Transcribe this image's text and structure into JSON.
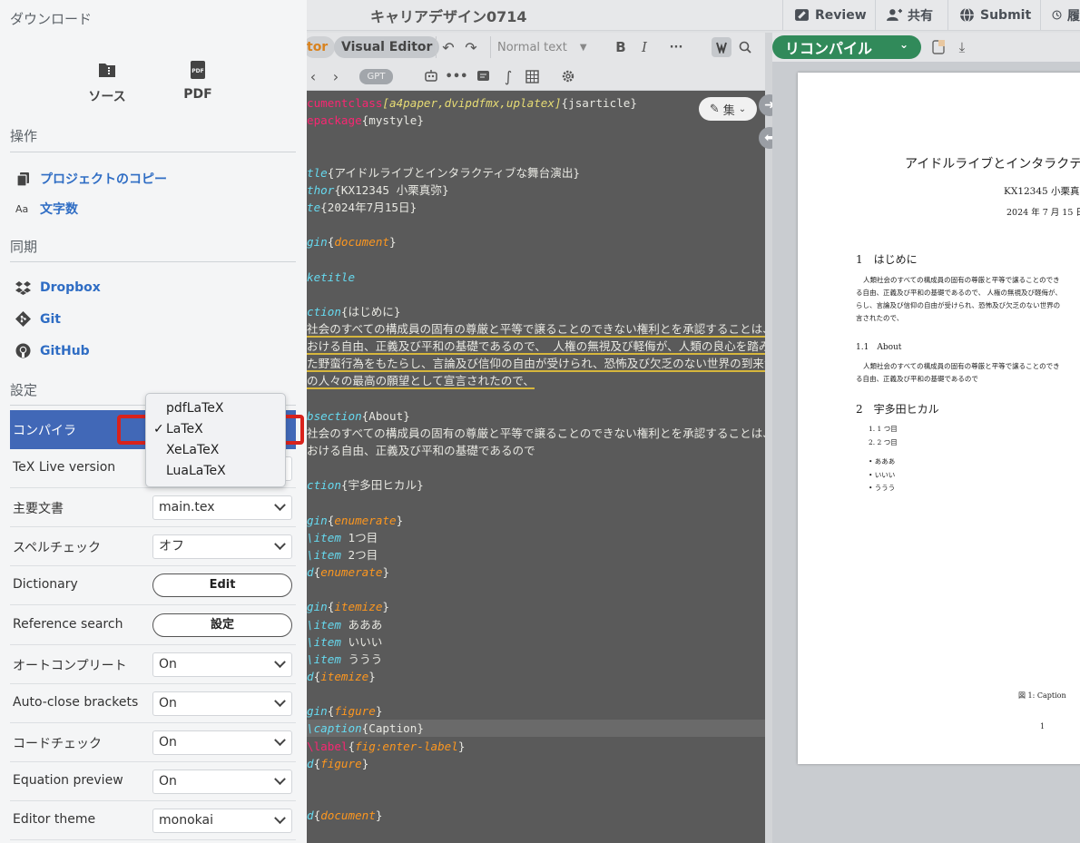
{
  "topbar": {
    "project_title": "キャリアデザイン0714",
    "review": "Review",
    "share": "共有",
    "submit": "Submit",
    "history": "履"
  },
  "editor_toolbar": {
    "mode_code": "tor",
    "mode_visual": "Visual Editor",
    "text_style": "Normal text",
    "bold": "B",
    "italic": "I",
    "more": "···",
    "gpt": "GPT"
  },
  "editor": {
    "edit_chip": "集",
    "lines": [
      [
        [
          "kw",
          "cumentclass"
        ],
        [
          "arg",
          "[a4paper,dvipdfmx,uplatex]"
        ],
        [
          "t",
          "{jsarticle}"
        ]
      ],
      [
        [
          "kw",
          "epackage"
        ],
        [
          "t",
          "{mystyle}"
        ]
      ],
      [],
      [],
      [
        [
          "cmd-i",
          "tle"
        ],
        [
          "t",
          "{アイドルライブとインタラクティブな舞台演出}"
        ]
      ],
      [
        [
          "cmd-i",
          "thor"
        ],
        [
          "t",
          "{KX12345 小栗真弥}"
        ]
      ],
      [
        [
          "cmd-i",
          "te"
        ],
        [
          "t",
          "{2024年7月15日}"
        ]
      ],
      [],
      [
        [
          "cmd-i",
          "gin"
        ],
        [
          "t",
          "{"
        ],
        [
          "env",
          "document"
        ],
        [
          "t",
          "}"
        ]
      ],
      [],
      [
        [
          "cmd-i",
          "ketitle"
        ]
      ],
      [],
      [
        [
          "cmd-i",
          "ction"
        ],
        [
          "t",
          "{はじめに}"
        ]
      ],
      [
        [
          "ul",
          "社会のすべての構成員の固有の尊厳と平等で譲ることのできない権利とを承認することは、世"
        ]
      ],
      [
        [
          "ul",
          "おける自由、正義及び平和の基礎であるので、 人権の無視及び軽侮が、人類の良心を踏みに"
        ]
      ],
      [
        [
          "ul",
          "た野蛮行為をもたらし、言論及び信仰の自由が受けられ、恐怖及び欠乏のない世界の到来が、"
        ]
      ],
      [
        [
          "ul",
          "の人々の最高の願望として宣言されたので、"
        ]
      ],
      [],
      [
        [
          "cmd-i",
          "bsection"
        ],
        [
          "t",
          "{About}"
        ]
      ],
      [
        [
          "t",
          "社会のすべての構成員の固有の尊厳と平等で譲ることのできない権利とを承認することは、世"
        ]
      ],
      [
        [
          "t",
          "おける自由、正義及び平和の基礎であるので"
        ]
      ],
      [],
      [
        [
          "cmd-i",
          "ction"
        ],
        [
          "t",
          "{宇多田ヒカル}"
        ]
      ],
      [],
      [
        [
          "cmd-i",
          "gin"
        ],
        [
          "t",
          "{"
        ],
        [
          "env",
          "enumerate"
        ],
        [
          "t",
          "}"
        ]
      ],
      [
        [
          "t",
          "  "
        ],
        [
          "cmd-i",
          "\\item"
        ],
        [
          "t",
          " 1つ目"
        ]
      ],
      [
        [
          "t",
          "  "
        ],
        [
          "cmd-i",
          "\\item"
        ],
        [
          "t",
          " 2つ目"
        ]
      ],
      [
        [
          "cmd-i",
          "d"
        ],
        [
          "t",
          "{"
        ],
        [
          "env",
          "enumerate"
        ],
        [
          "t",
          "}"
        ]
      ],
      [],
      [
        [
          "cmd-i",
          "gin"
        ],
        [
          "t",
          "{"
        ],
        [
          "env",
          "itemize"
        ],
        [
          "t",
          "}"
        ]
      ],
      [
        [
          "t",
          "  "
        ],
        [
          "cmd-i",
          "\\item"
        ],
        [
          "t",
          " あああ"
        ]
      ],
      [
        [
          "t",
          "  "
        ],
        [
          "cmd-i",
          "\\item"
        ],
        [
          "t",
          " いいい"
        ]
      ],
      [
        [
          "t",
          "  "
        ],
        [
          "cmd-i",
          "\\item"
        ],
        [
          "t",
          " ううう"
        ]
      ],
      [
        [
          "cmd-i",
          "d"
        ],
        [
          "t",
          "{"
        ],
        [
          "env",
          "itemize"
        ],
        [
          "t",
          "}"
        ]
      ],
      [],
      [
        [
          "cmd-i",
          "gin"
        ],
        [
          "t",
          "{"
        ],
        [
          "env",
          "figure"
        ],
        [
          "t",
          "}"
        ]
      ],
      [
        [
          "t",
          "  "
        ],
        [
          "cmd-i",
          "\\caption"
        ],
        [
          "t",
          "{Caption}"
        ]
      ],
      [
        [
          "t",
          "  "
        ],
        [
          "kw",
          "\\label"
        ],
        [
          "t",
          "{"
        ],
        [
          "env",
          "fig:enter-label"
        ],
        [
          "t",
          "}"
        ]
      ],
      [
        [
          "cmd-i",
          "d"
        ],
        [
          "t",
          "{"
        ],
        [
          "env",
          "figure"
        ],
        [
          "t",
          "}"
        ]
      ],
      [],
      [],
      [
        [
          "cmd-i",
          "d"
        ],
        [
          "t",
          "{"
        ],
        [
          "env",
          "document"
        ],
        [
          "t",
          "}"
        ]
      ]
    ]
  },
  "pdf": {
    "recompile": "リコンパイル",
    "title": "アイドルライブとインタラクテ",
    "author": "KX12345 小栗真弥",
    "date": "2024 年 7 月 15 日",
    "sec1": "1　はじめに",
    "sec1_body": [
      "人類社会のすべての構成員の固有の尊厳と平等で譲ることのでき",
      "る自由、正義及び平和の基礎であるので、 人権の無視及び軽侮が、",
      "らし、言論及び信仰の自由が受けられ、恐怖及び欠乏のない世界の",
      "言されたので、"
    ],
    "sub1": "1.1　About",
    "sub1_body": [
      "人類社会のすべての構成員の固有の尊厳と平等で譲ることのでき",
      "る自由、正義及び平和の基礎であるので"
    ],
    "sec2": "2　宇多田ヒカル",
    "enum": [
      "1. 1 つ目",
      "2. 2 つ目"
    ],
    "items": [
      "• あああ",
      "• いいい",
      "• ううう"
    ],
    "caption": "図 1: Caption",
    "page_num": "1"
  },
  "menu": {
    "download_heading": "ダウンロード",
    "source": "ソース",
    "pdf": "PDF",
    "actions_heading": "操作",
    "copy_project": "プロジェクトのコピー",
    "word_count": "文字数",
    "word_count_icon": "Aa",
    "sync_heading": "同期",
    "dropbox": "Dropbox",
    "git": "Git",
    "github": "GitHub",
    "settings_heading": "設定",
    "settings": [
      {
        "label": "コンパイラ",
        "value": "LaTeX",
        "kind": "select",
        "selected": true
      },
      {
        "label": "TeX Live version",
        "value": "",
        "kind": "select"
      },
      {
        "label": "主要文書",
        "value": "main.tex",
        "kind": "select"
      },
      {
        "label": "スペルチェック",
        "value": "オフ",
        "kind": "select"
      },
      {
        "label": "Dictionary",
        "value": "Edit",
        "kind": "button"
      },
      {
        "label": "Reference search",
        "value": "設定",
        "kind": "button"
      },
      {
        "label": "オートコンプリート",
        "value": "On",
        "kind": "select"
      },
      {
        "label": "Auto-close brackets",
        "value": "On",
        "kind": "select"
      },
      {
        "label": "コードチェック",
        "value": "On",
        "kind": "select"
      },
      {
        "label": "Equation preview",
        "value": "On",
        "kind": "select"
      },
      {
        "label": "Editor theme",
        "value": "monokai",
        "kind": "select"
      }
    ],
    "compiler_options": [
      "pdfLaTeX",
      "LaTeX",
      "XeLaTeX",
      "LuaLaTeX"
    ],
    "compiler_selected": "LaTeX",
    "check_mark": "✓"
  },
  "colors": {
    "accent_blue": "#4168b7",
    "link_blue": "#2f6dc4",
    "recompile_green": "#318a5a",
    "highlight_red": "#d9221c"
  }
}
